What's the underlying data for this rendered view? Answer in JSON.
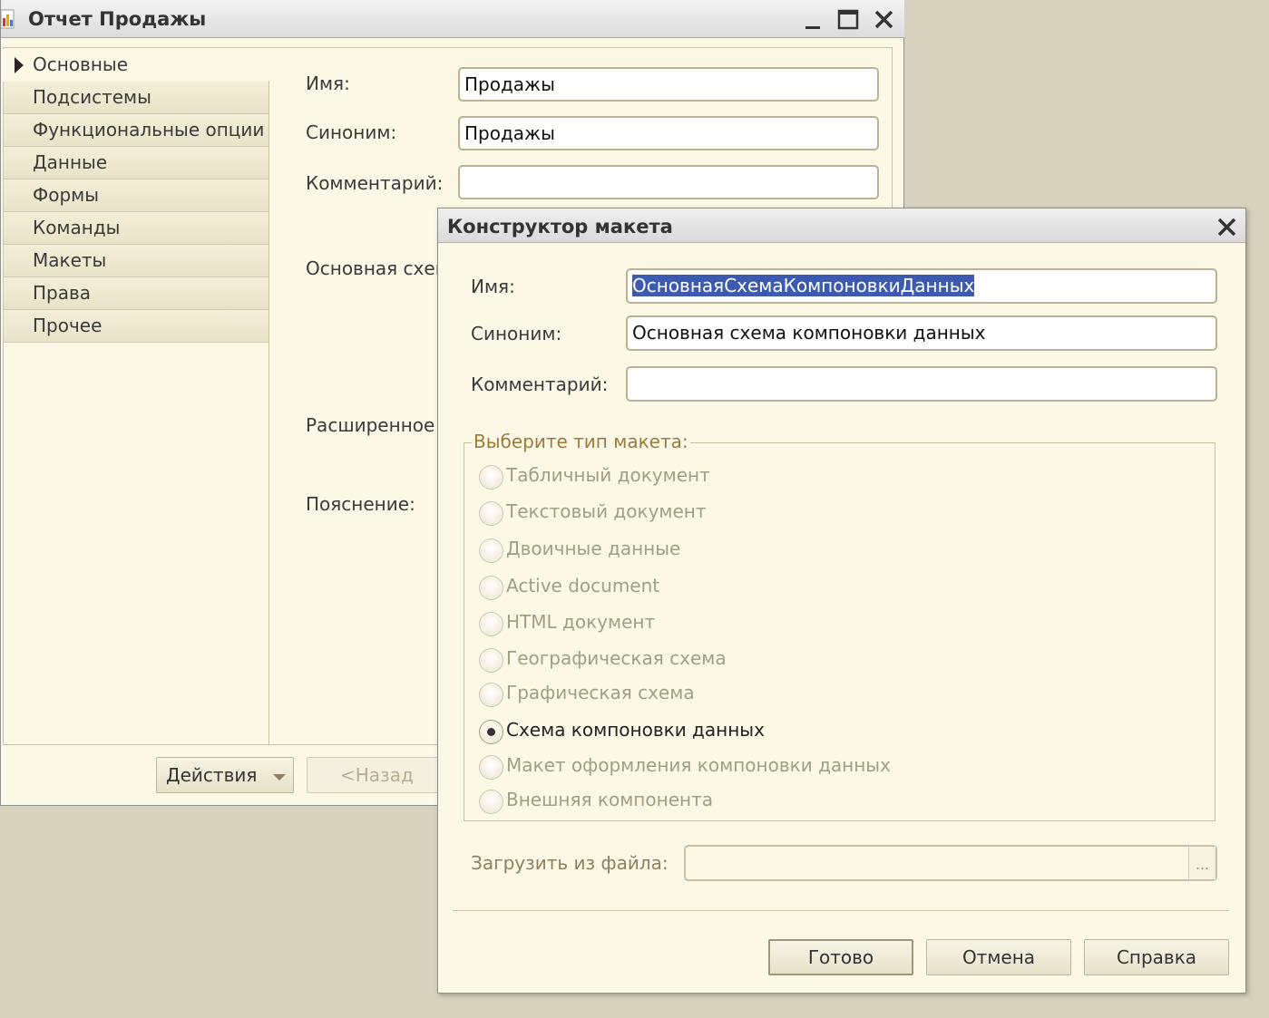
{
  "main_window": {
    "title": "Отчет Продажы",
    "nav_items": [
      "Основные",
      "Подсистемы",
      "Функциональные опции",
      "Данные",
      "Формы",
      "Команды",
      "Макеты",
      "Права",
      "Прочее"
    ],
    "fields": {
      "name_label": "Имя:",
      "name_value": "Продажы",
      "synonym_label": "Синоним:",
      "synonym_value": "Продажы",
      "comment_label": "Комментарий:",
      "comment_value": "",
      "main_schema_label": "Основная схем",
      "extended_label": "Расширенное",
      "explanation_label": "Пояснение:"
    },
    "buttons": {
      "actions_label": "Действия",
      "back_label": "<Назад"
    }
  },
  "dialog": {
    "title": "Конструктор макета",
    "name_label": "Имя:",
    "name_value": "ОсновнаяСхемаКомпоновкиДанных",
    "synonym_label": "Синоним:",
    "synonym_value": "Основная схема компоновки данных",
    "comment_label": "Комментарий:",
    "comment_value": "",
    "group_title": "Выберите тип макета:",
    "layout_types": [
      {
        "label": "Табличный документ",
        "checked": false
      },
      {
        "label": "Текстовый документ",
        "checked": false
      },
      {
        "label": "Двоичные данные",
        "checked": false
      },
      {
        "label": "Active document",
        "checked": false
      },
      {
        "label": "HTML документ",
        "checked": false
      },
      {
        "label": "Географическая схема",
        "checked": false
      },
      {
        "label": "Графическая схема",
        "checked": false
      },
      {
        "label": "Схема компоновки данных",
        "checked": true
      },
      {
        "label": "Макет оформления компоновки данных",
        "checked": false
      },
      {
        "label": "Внешняя компонента",
        "checked": false
      }
    ],
    "load_label": "Загрузить из файла:",
    "load_value": "",
    "browse_label": "...",
    "buttons": {
      "done": "Готово",
      "cancel": "Отмена",
      "help": "Справка"
    }
  },
  "colors": {
    "background": "#d7d1bd",
    "panel": "#fbf8e5",
    "selection": "#3c5bb0",
    "group_title": "#9c7a3c"
  }
}
